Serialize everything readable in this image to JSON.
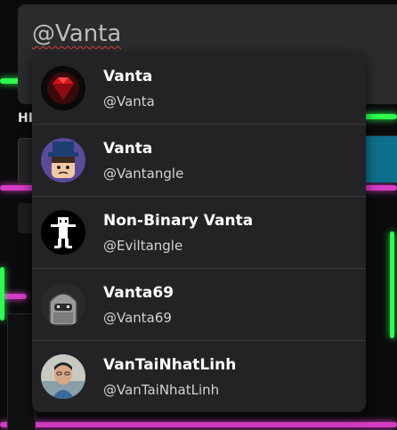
{
  "search": {
    "query": "@Vanta"
  },
  "background": {
    "section_label": "HI"
  },
  "suggestions": [
    {
      "display_name": "Vanta",
      "username": "@Vanta",
      "avatar_icon": "red-diamond-icon"
    },
    {
      "display_name": "Vanta",
      "username": "@Vantangle",
      "avatar_icon": "top-hat-face-icon"
    },
    {
      "display_name": "Non-Binary Vanta",
      "username": "@Eviltangle",
      "avatar_icon": "white-figure-icon"
    },
    {
      "display_name": "Vanta69",
      "username": "@Vanta69",
      "avatar_icon": "hooded-avatar-icon"
    },
    {
      "display_name": "VanTaiNhatLinh",
      "username": "@VanTaiNhatLinh",
      "avatar_icon": "person-photo-icon"
    }
  ],
  "colors": {
    "dropdown_bg": "#232325",
    "neon_green": "#2cff4f",
    "neon_pink": "#d43cc4"
  }
}
